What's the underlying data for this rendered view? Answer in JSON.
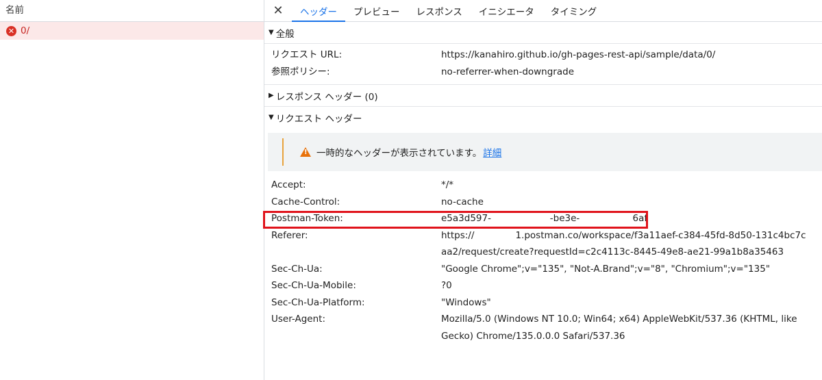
{
  "left": {
    "header": "名前",
    "rows": [
      {
        "label": "0/"
      }
    ]
  },
  "tabs": [
    "ヘッダー",
    "プレビュー",
    "レスポンス",
    "イニシエータ",
    "タイミング"
  ],
  "general": {
    "title": "全般",
    "rows": [
      {
        "k": "リクエスト URL:",
        "v": "https://kanahiro.github.io/gh-pages-rest-api/sample/data/0/"
      },
      {
        "k": "参照ポリシー:",
        "v": "no-referrer-when-downgrade"
      }
    ]
  },
  "response_headers": {
    "title": "レスポンス ヘッダー (0)"
  },
  "request_headers": {
    "title": "リクエスト ヘッダー",
    "warning": "一時的なヘッダーが表示されています。",
    "warning_link": "詳細",
    "rows": [
      {
        "k": "Accept:",
        "v": "*/*"
      },
      {
        "k": "Cache-Control:",
        "v": "no-cache"
      },
      {
        "k": "Postman-Token:",
        "v": "e5a3d597-                    -be3e-                  6af"
      },
      {
        "k": "Referer:",
        "v": "https://              1.postman.co/workspace/f3a11aef-c384-45fd-8d50-131c4bc7caa2/request/create?requestId=c2c4113c-8445-49e8-ae21-99a1b8a35463"
      },
      {
        "k": "Sec-Ch-Ua:",
        "v": "\"Google Chrome\";v=\"135\", \"Not-A.Brand\";v=\"8\", \"Chromium\";v=\"135\""
      },
      {
        "k": "Sec-Ch-Ua-Mobile:",
        "v": "?0"
      },
      {
        "k": "Sec-Ch-Ua-Platform:",
        "v": "\"Windows\""
      },
      {
        "k": "User-Agent:",
        "v": "Mozilla/5.0 (Windows NT 10.0; Win64; x64) AppleWebKit/537.36 (KHTML, like Gecko) Chrome/135.0.0.0 Safari/537.36"
      }
    ]
  }
}
